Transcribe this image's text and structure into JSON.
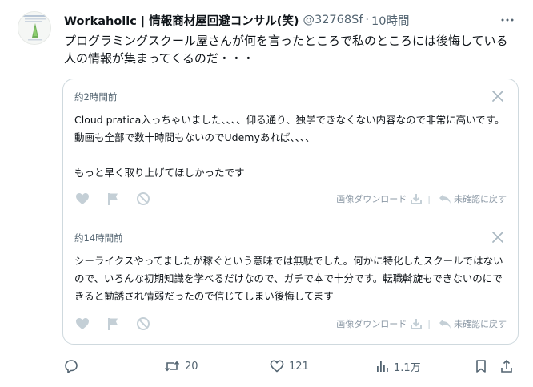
{
  "tweet": {
    "author_name": "Workaholic | 情報商材屋回避コンサル(笑)",
    "handle": "@32768Sf",
    "separator": "·",
    "time": "10時間",
    "more_icon": "more-icon",
    "text": "プログラミングスクール屋さんが何を言ったところで私のところには後悔している人の情報が集まってくるのだ・・・"
  },
  "reviews": [
    {
      "time": "約2時間前",
      "lines": [
        "Cloud pratica入っちゃいました、、、、仰る通り、独学できなくない内容なので非常に高いです。動画も全部で数十時間もないのでUdemyあれば、、、、",
        "",
        "もっと早く取り上げてほしかったです"
      ],
      "download_label": "画像ダウンロード",
      "separator": "|",
      "back_label": "未確認に戻す"
    },
    {
      "time": "約14時間前",
      "lines": [
        "シーライクスやってましたが稼ぐという意味では無駄でした。何かに特化したスクールではないので、いろんな初期知識を学べるだけなので、ガチで本で十分です。転職斡旋もできないのにできると勧誘され情弱だったので信じてしまい後悔してます"
      ],
      "download_label": "画像ダウンロード",
      "separator": "|",
      "back_label": "未確認に戻す"
    }
  ],
  "actions": {
    "replies": "",
    "retweets": "20",
    "likes": "121",
    "views": "1.1万"
  },
  "colors": {
    "text": "#0f1419",
    "muted": "#536471",
    "border": "#cfd9de",
    "review_icon": "#c4cfd6"
  }
}
